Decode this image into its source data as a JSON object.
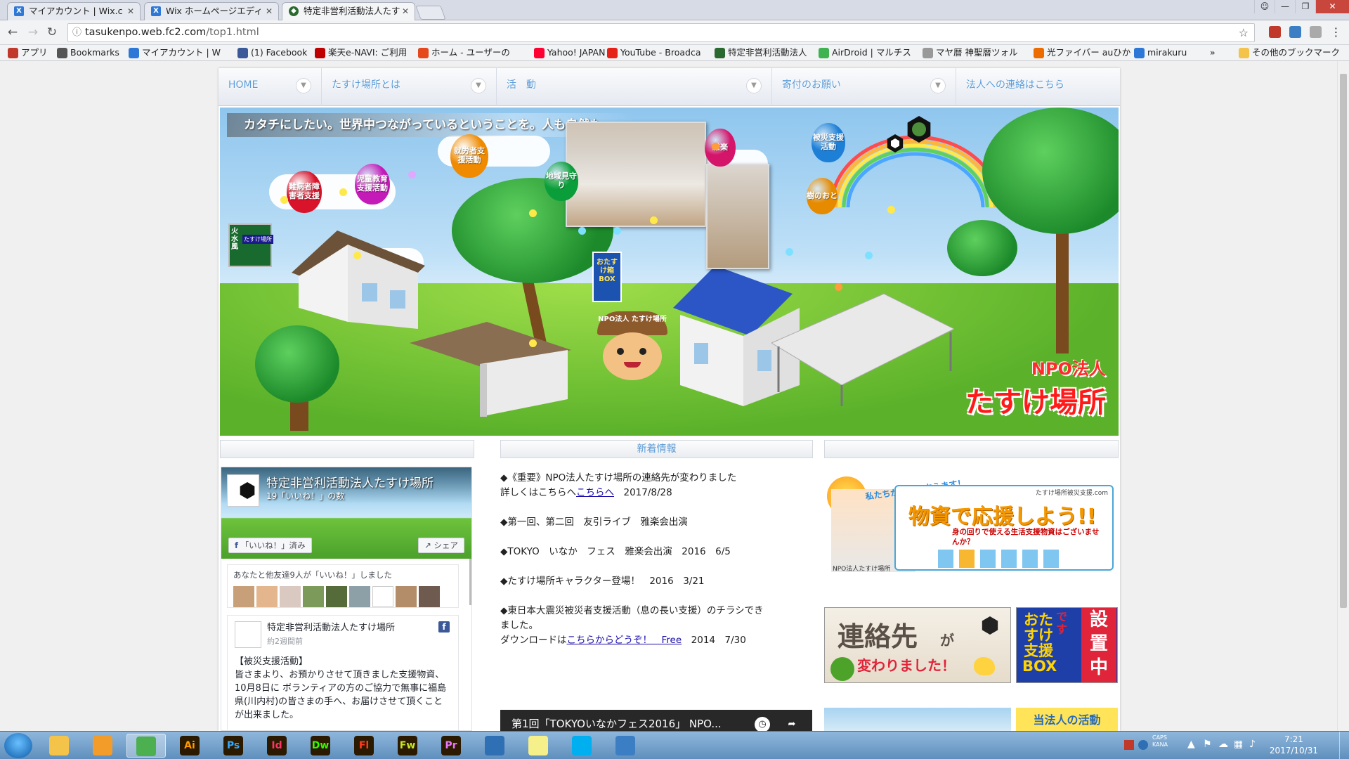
{
  "browser": {
    "tabs": [
      {
        "title": "マイアカウント | Wix.c",
        "icon": "wix-icon",
        "color": "#2d78d6"
      },
      {
        "title": "Wix ホームページエディ",
        "icon": "wix-icon",
        "color": "#2d78d6"
      },
      {
        "title": "特定非営利活動法人たす",
        "icon": "tasuke-icon",
        "color": "#2a6a2e"
      }
    ],
    "url_domain": "tasukenpo.web.fc2.com",
    "url_path": "/top1.html",
    "bookmarks": [
      {
        "label": "アプリ",
        "icon": "apps-grid-icon",
        "color": "#c0392b"
      },
      {
        "label": "Bookmarks",
        "icon": "star-icon",
        "color": "#555555"
      },
      {
        "label": "マイアカウント | W",
        "icon": "wix-icon",
        "color": "#2d78d6"
      },
      {
        "label": "(1) Facebook",
        "icon": "facebook-icon",
        "color": "#3b5998"
      },
      {
        "label": "楽天e-NAVI: ご利用",
        "icon": "rakuten-icon",
        "color": "#bf0000"
      },
      {
        "label": "ホーム - ユーザーの",
        "icon": "au-icon",
        "color": "#e5481c"
      },
      {
        "label": "Yahoo! JAPAN",
        "icon": "yahoo-icon",
        "color": "#ff0033"
      },
      {
        "label": "YouTube - Broadca",
        "icon": "youtube-icon",
        "color": "#e62117"
      },
      {
        "label": "特定非営利活動法人",
        "icon": "tasuke-icon",
        "color": "#2a6a2e"
      },
      {
        "label": "AirDroid | マルチス",
        "icon": "airdroid-icon",
        "color": "#3fb34f"
      },
      {
        "label": "マヤ暦 神聖暦ツォル",
        "icon": "maya-icon",
        "color": "#999999"
      },
      {
        "label": "光ファイバー auひか",
        "icon": "au-icon",
        "color": "#ec6c00"
      },
      {
        "label": "mirakuru",
        "icon": "wix-icon",
        "color": "#2d78d6"
      }
    ],
    "bookmarks_overflow": "»",
    "other_bookmarks": "その他のブックマーク"
  },
  "site": {
    "nav": [
      {
        "label": "HOME"
      },
      {
        "label": "たすけ場所とは"
      },
      {
        "label": "活　動"
      },
      {
        "label": "寄付のお願い"
      },
      {
        "label": "法人への連絡はこちら"
      }
    ],
    "hero": {
      "slogan": "カタチにしたい。世界中つながっているということを。人も自然も。",
      "balloons": [
        {
          "text": "難病者障害者支援",
          "color": "#d8132a"
        },
        {
          "text": "児童教育支援活動",
          "color": "#c41ab8"
        },
        {
          "text": "就労者支援活動",
          "color": "#f08a00"
        },
        {
          "text": "地域見守り",
          "color": "#0a9e3b"
        },
        {
          "text": "雅楽",
          "color": "#d4156a"
        },
        {
          "text": "被災支援活動",
          "color": "#1e7fd6"
        },
        {
          "text": "樹のおと",
          "color": "#e68a00"
        }
      ],
      "signboard": "たすけ場所",
      "signboard_side": "火水風",
      "box_label": "おたすけ箱BOX",
      "mascot_hat": "NPO法人 たすけ場所",
      "npo_label": "NPO法人",
      "org_name": "たすけ場所"
    },
    "news_header": "新着情報",
    "facebook": {
      "page_name": "特定非営利活動法人たすけ場所",
      "likes": "19「いいね！」の数",
      "liked_button": "「いいね！」済み",
      "share_button": "シェア",
      "friends_text": "あなたと他友達9人が「いいね！」しました",
      "post_author": "特定非営利活動法人たすけ場所",
      "post_time": "約2週間前",
      "post_body": "【被災支援活動】\n皆さまより、お預かりさせて頂きました支援物資、10月8日に ボランティアの方のご協力で無事に福島県(川内村)の皆さまの手へ、お届けさせて頂くことが出来ました。"
    },
    "news": [
      {
        "line1": "◆《重要》NPO法人たすけ場所の連絡先が変わりました",
        "pre": "詳しくはこちらへ",
        "link": "こちらへ",
        "post": "　2017/8/28"
      },
      {
        "text": "◆第一回、第二回　友引ライブ　雅楽会出演"
      },
      {
        "text": "◆TOKYO　いなか　フェス　雅楽会出演　2016　6/5"
      },
      {
        "text": "◆たすけ場所キャラクター登場！　2016　3/21"
      },
      {
        "line1": "◆東日本大震災被災者支援活動（息の長い支援）のチラシできました。",
        "pre": "ダウンロードは",
        "link": "こちらからどうぞ！　Free",
        "post": "　2014　7/30"
      }
    ],
    "video_title": "第1回「TOKYOいなかフェス2016」 NPO...",
    "banners": {
      "support_top": "私たちが活動を支えます！",
      "support_small": "たすけ場所被災支援.com",
      "support_main": "物資で応援しよう!!",
      "support_sub": "身の回りで使える生活支援物資はございませんか？",
      "support_org": "NPO法人たすけ場所",
      "contact_main": "連絡先",
      "contact_ga": "が",
      "contact_sub": "変わりました！",
      "box_vertical": "おたすけ支援BOX",
      "box_right": "です",
      "box_setchi": "設置中",
      "activity_label": "当法人の活動"
    }
  },
  "taskbar": {
    "apps": [
      {
        "label": "",
        "icon": "explorer-folder-icon",
        "color": "#f3c34a"
      },
      {
        "label": "",
        "icon": "media-player-icon",
        "color": "#f39c2a"
      },
      {
        "label": "",
        "icon": "chrome-icon",
        "color": "#4caf50"
      },
      {
        "label": "Ai",
        "icon": "illustrator-icon",
        "color": "#ff9a00"
      },
      {
        "label": "Ps",
        "icon": "photoshop-icon",
        "color": "#31a8ff"
      },
      {
        "label": "Id",
        "icon": "indesign-icon",
        "color": "#ff3366"
      },
      {
        "label": "Dw",
        "icon": "dreamweaver-icon",
        "color": "#35fa00"
      },
      {
        "label": "Fl",
        "icon": "flash-icon",
        "color": "#ff3c1f"
      },
      {
        "label": "Fw",
        "icon": "fireworks-icon",
        "color": "#c4e627"
      },
      {
        "label": "Pr",
        "icon": "premiere-icon",
        "color": "#ea77ff"
      },
      {
        "label": "",
        "icon": "thunderbird-icon",
        "color": "#2f6fb3"
      },
      {
        "label": "",
        "icon": "sticky-notes-icon",
        "color": "#f6f08a"
      },
      {
        "label": "",
        "icon": "skype-icon",
        "color": "#00aff0"
      },
      {
        "label": "",
        "icon": "network-icon",
        "color": "#3c7ec4"
      }
    ],
    "ime": "CAPS KANA",
    "time": "7:21",
    "date": "2017/10/31"
  }
}
